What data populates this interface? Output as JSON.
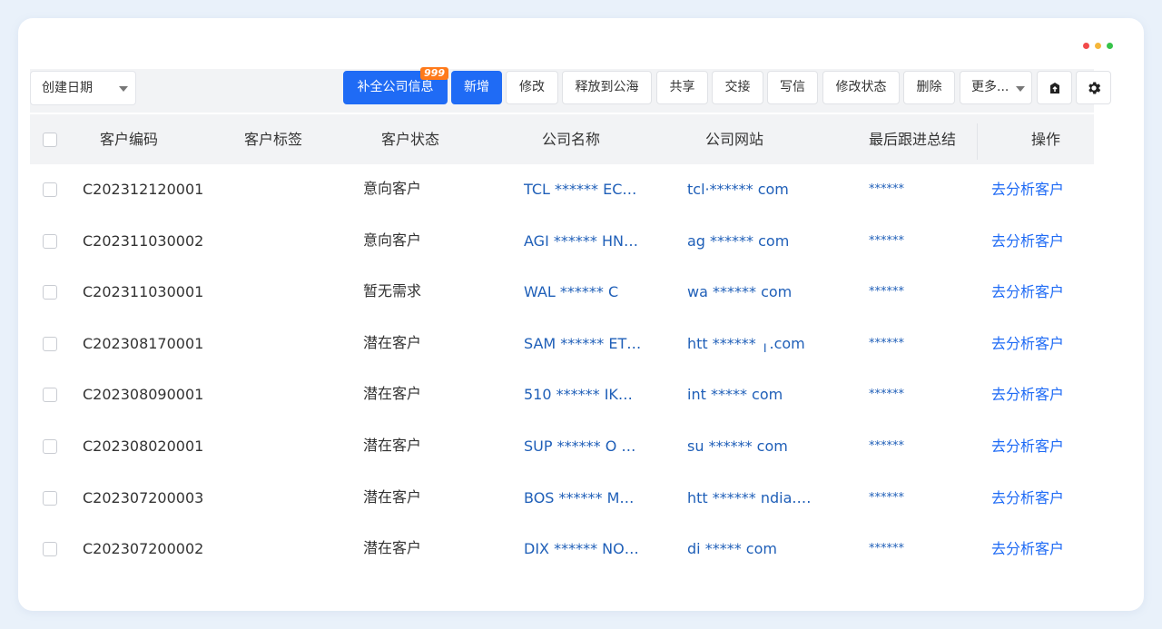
{
  "window": {
    "dot_colors": [
      "#f24a4a",
      "#f5b73b",
      "#37c34a"
    ]
  },
  "toolbar": {
    "date_select": "创建日期",
    "buttons": [
      {
        "label": "补全公司信息",
        "badge": "999",
        "primary": true
      },
      {
        "label": "新增",
        "primary": true
      },
      {
        "label": "修改"
      },
      {
        "label": "释放到公海"
      },
      {
        "label": "共享"
      },
      {
        "label": "交接"
      },
      {
        "label": "写信"
      },
      {
        "label": "修改状态"
      },
      {
        "label": "删除"
      },
      {
        "label": "更多..."
      }
    ],
    "icons": [
      "export-icon",
      "gear-icon"
    ]
  },
  "table": {
    "headers": {
      "code": "客户编码",
      "tag": "客户标签",
      "status": "客户状态",
      "company": "公司名称",
      "website": "公司网站",
      "follow": "最后跟进总结",
      "action": "操作"
    },
    "rows": [
      {
        "code": "C202312120001",
        "status": "意向客户",
        "company": "TCL  ****** EC…",
        "website": "tcl·****** com",
        "follow": "******",
        "action": "去分析客户"
      },
      {
        "code": "C202311030002",
        "status": "意向客户",
        "company": "AGI  ******  HN…",
        "website": "ag ****** com",
        "follow": "******",
        "action": "去分析客户"
      },
      {
        "code": "C202311030001",
        "status": "暂无需求",
        "company": "WAL  ****** C",
        "website": "wa ****** com",
        "follow": "******",
        "action": "去分析客户"
      },
      {
        "code": "C202308170001",
        "status": "潜在客户",
        "company": "SAM  ******  ET…",
        "website": "htt ****** ╷.com",
        "follow": "******",
        "action": "去分析客户"
      },
      {
        "code": "C202308090001",
        "status": "潜在客户",
        "company": "510  ******  IK…",
        "website": "int ***** com",
        "follow": "******",
        "action": "去分析客户"
      },
      {
        "code": "C202308020001",
        "status": "潜在客户",
        "company": "SUP  ****** O …",
        "website": "su ****** com",
        "follow": "******",
        "action": "去分析客户"
      },
      {
        "code": "C202307200003",
        "status": "潜在客户",
        "company": "BOS  ******  M…",
        "website": "htt ****** ndia.…",
        "follow": "******",
        "action": "去分析客户"
      },
      {
        "code": "C202307200002",
        "status": "潜在客户",
        "company": "DIX  ****** NO…",
        "website": "di ***** com",
        "follow": "******",
        "action": "去分析客户"
      }
    ]
  }
}
